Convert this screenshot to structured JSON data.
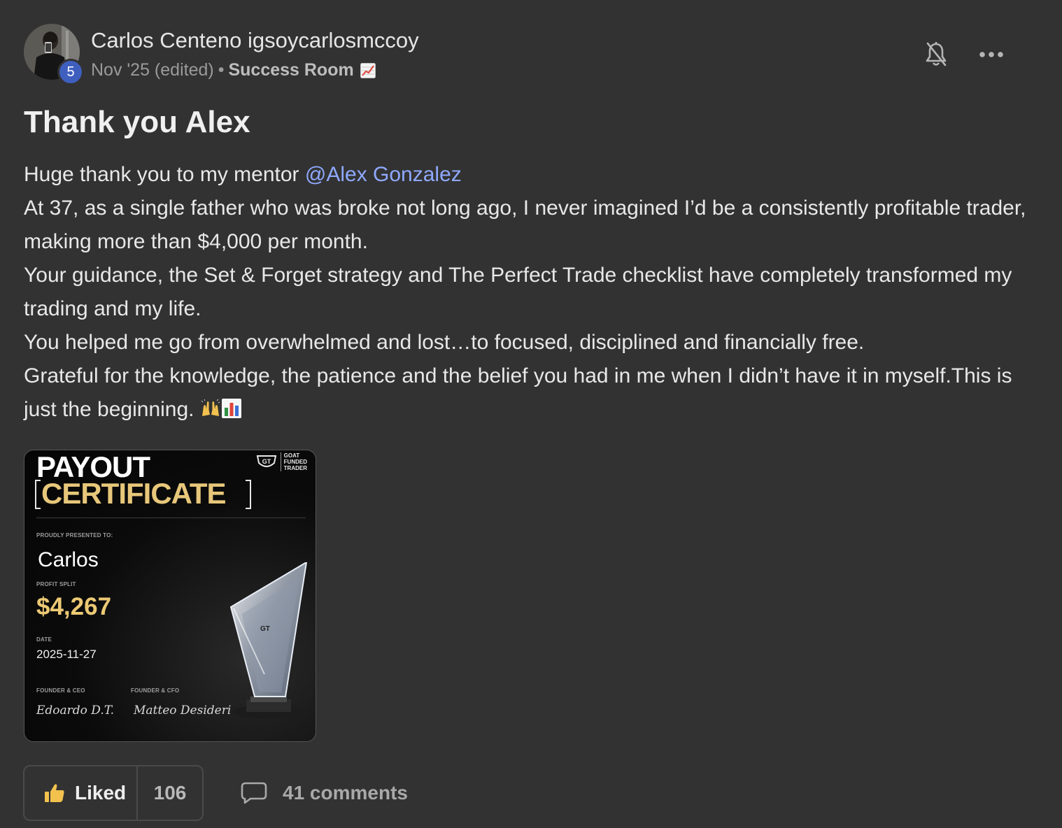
{
  "author": {
    "name": "Carlos Centeno igsoycarlosmccoy",
    "level": "5",
    "avatar_icon": "profile-photo"
  },
  "meta": {
    "date": "Nov '25 (edited)",
    "separator": "•",
    "category": "Success Room",
    "category_emoji": "chart-increasing-emoji"
  },
  "actions": {
    "bell_icon": "bell-off-icon",
    "more_icon": "more-horizontal-icon"
  },
  "post": {
    "title": "Thank you Alex",
    "line1_prefix": "Huge thank you to my mentor ",
    "mention": "@Alex Gonzalez",
    "paragraph2": "At 37, as a single father who was broke not long ago, I never imagined I’d be a consistently profitable trader, making more than $4,000 per month.",
    "paragraph3": "Your guidance, the Set & Forget strategy and The Perfect Trade checklist have completely transformed my trading and my life.",
    "paragraph4": "You helped me go from overwhelmed and lost…to focused, disciplined and financially free.",
    "paragraph5": "Grateful for the knowledge, the patience and the belief you had in me when I didn’t have it in myself.This is just the beginning.",
    "trailing_emojis": [
      "raising-hands-emoji",
      "bar-chart-emoji"
    ]
  },
  "certificate": {
    "heading1": "PAYOUT",
    "heading2": "CERTIFICATE",
    "brand_line1": "GOAT",
    "brand_line2": "FUNDED",
    "brand_line3": "TRADER",
    "presented_label": "PROUDLY PRESENTED TO:",
    "name": "Carlos",
    "profit_label": "PROFIT SPLIT",
    "amount": "$4,267",
    "date_label": "DATE",
    "date": "2025-11-27",
    "ceo_label": "FOUNDER & CEO",
    "ceo_signature": "Edoardo D.T.",
    "cfo_label": "FOUNDER & CFO",
    "cfo_signature": "Matteo Desideri",
    "gold_color": "#e7c77a"
  },
  "footer": {
    "like_label": "Liked",
    "like_count": "106",
    "comments_label": "41 comments",
    "like_icon": "thumbs-up-icon",
    "comment_icon": "comment-bubble-icon"
  }
}
